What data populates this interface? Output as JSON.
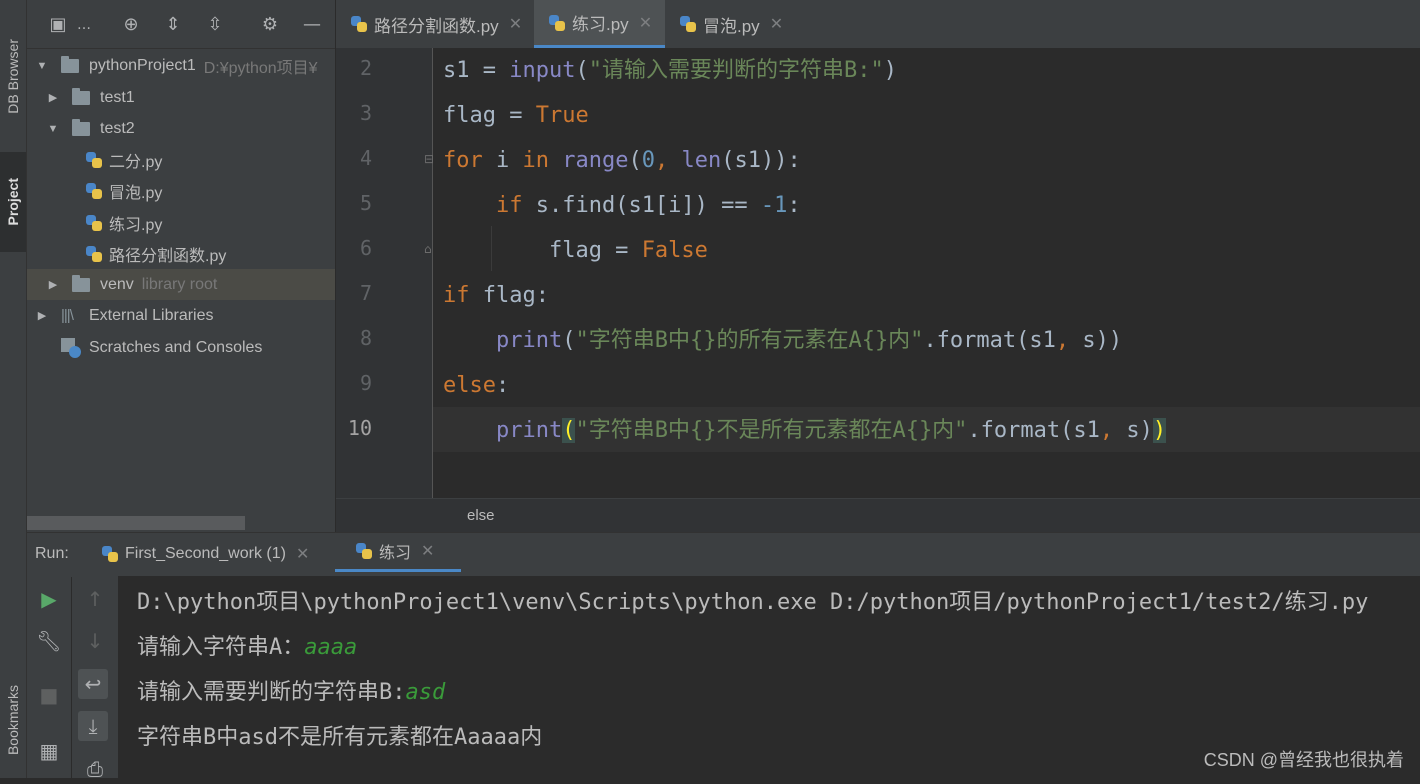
{
  "left_strip": {
    "db_browser": "DB Browser",
    "project": "Project",
    "bookmarks": "Bookmarks"
  },
  "project_tree": [
    {
      "label": "pythonProject1",
      "hint": "D:¥python项目¥",
      "kind": "folder",
      "depth": 0,
      "expanded": true
    },
    {
      "label": "test1",
      "kind": "folder",
      "depth": 1,
      "expanded": false
    },
    {
      "label": "test2",
      "kind": "folder",
      "depth": 1,
      "expanded": true
    },
    {
      "label": "二分.py",
      "kind": "py",
      "depth": 2
    },
    {
      "label": "冒泡.py",
      "kind": "py",
      "depth": 2
    },
    {
      "label": "练习.py",
      "kind": "py",
      "depth": 2
    },
    {
      "label": "路径分割函数.py",
      "kind": "py",
      "depth": 2
    },
    {
      "label": "venv",
      "hint": "library root",
      "kind": "folder",
      "depth": 1,
      "expanded": false,
      "selected": true
    },
    {
      "label": "External Libraries",
      "kind": "libs",
      "depth": 0
    },
    {
      "label": "Scratches and Consoles",
      "kind": "scratch",
      "depth": 0
    }
  ],
  "editor_tabs": [
    {
      "label": "路径分割函数.py",
      "active": false
    },
    {
      "label": "练习.py",
      "active": true
    },
    {
      "label": "冒泡.py",
      "active": false
    }
  ],
  "line_numbers": [
    "2",
    "3",
    "4",
    "5",
    "6",
    "7",
    "8",
    "9",
    "10"
  ],
  "code": {
    "l2": {
      "a": "s1 = ",
      "b": "input",
      "c": "(",
      "d": "\"请输入需要判断的字符串B:\"",
      "e": ")"
    },
    "l3": {
      "a": "flag = ",
      "b": "True"
    },
    "l4": {
      "a": "for",
      "b": " i ",
      "c": "in",
      "d": " ",
      "e": "range",
      "f": "(",
      "g": "0",
      "h": ", ",
      "i": "len",
      "j": "(s1)):"
    },
    "l5": {
      "a": "    ",
      "b": "if",
      "c": " s.find(s1[i]) == ",
      "d": "-1",
      "e": ":"
    },
    "l6": {
      "a": "        flag = ",
      "b": "False"
    },
    "l7": {
      "a": "if",
      "b": " flag:"
    },
    "l8": {
      "a": "    ",
      "b": "print",
      "c": "(",
      "d": "\"字符串B中{}的所有元素在A{}内\"",
      "e": ".format(s1",
      "f": ",",
      "g": " s))"
    },
    "l9": {
      "a": "else",
      "b": ":"
    },
    "l10": {
      "a": "    ",
      "b": "print",
      "c": "(",
      "d": "\"字符串B中{}不是所有元素都在A{}内\"",
      "e": ".format(s1",
      "f": ",",
      "g": " s)",
      "h": ")"
    }
  },
  "breadcrumb": "else",
  "run": {
    "label": "Run:",
    "tabs": [
      {
        "label": "First_Second_work (1)",
        "active": false
      },
      {
        "label": "练习",
        "active": true
      }
    ],
    "console": [
      {
        "text": "D:\\python项目\\pythonProject1\\venv\\Scripts\\python.exe D:/python项目/pythonProject1/test2/练习.py",
        "input": ""
      },
      {
        "text": "请输入字符串A：",
        "input": "aaaa"
      },
      {
        "text": "请输入需要判断的字符串B:",
        "input": "asd"
      },
      {
        "text": "字符串B中asd不是所有元素都在Aaaaa内",
        "input": ""
      }
    ]
  },
  "watermark": "CSDN @曾经我也很执着",
  "colors": {
    "keyword": "#cc7832",
    "builtin": "#8888c6",
    "string": "#6a8759",
    "number": "#6897bb",
    "accent": "#4a88c7"
  }
}
